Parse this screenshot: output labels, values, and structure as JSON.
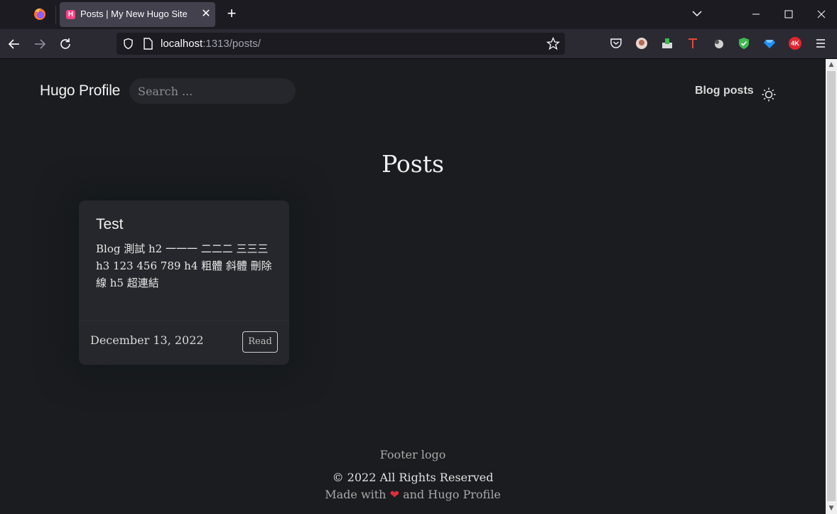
{
  "browser": {
    "tab_title": "Posts | My New Hugo Site",
    "url_host": "localhost",
    "url_rest": ":1313/posts/",
    "colors": {
      "tabbar": "#1c1b22",
      "toolbar": "#2b2a33",
      "tab_active": "#42414d"
    },
    "extensions": [
      "pocket-icon",
      "avatar-extension-icon",
      "download-extension-icon",
      "t-extension-icon",
      "ghost-extension-icon",
      "shield-extension-icon",
      "gem-extension-icon",
      "4k-extension-icon"
    ],
    "ext_4k_label": "4K"
  },
  "header": {
    "brand": "Hugo Profile",
    "search_placeholder": "Search ...",
    "nav_blog": "Blog posts"
  },
  "main": {
    "heading": "Posts",
    "posts": [
      {
        "title": "Test",
        "excerpt": "Blog 測試 h2 一一一 二二二 三三三 h3 123 456 789 h4 粗體 斜體 刪除線 h5 超連結",
        "date": "December 13, 2022",
        "read_label": "Read"
      }
    ]
  },
  "footer": {
    "logo_text": "Footer logo",
    "copyright": "© 2022 All Rights Reserved",
    "made_with_prefix": "Made with",
    "heart": "❤",
    "made_with_suffix": "and Hugo Profile"
  },
  "colors": {
    "page_bg": "#1b1c1f",
    "card_bg": "#25272c",
    "heart": "#e02d3c"
  }
}
